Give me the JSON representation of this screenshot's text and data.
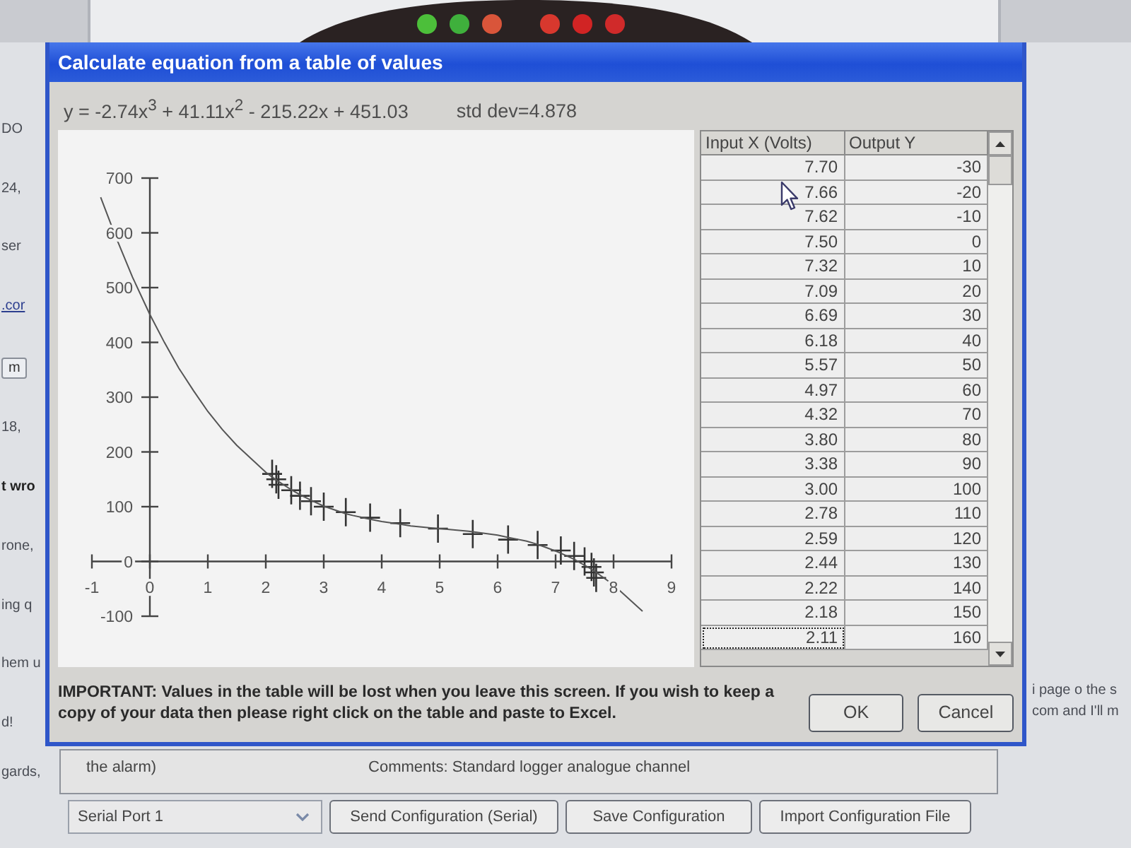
{
  "top_panel": {
    "indicators": [
      {
        "color": "#4cbf3a"
      },
      {
        "color": "#3fb03c"
      },
      {
        "color": "#d9553a"
      },
      {
        "color": "#d8382e"
      },
      {
        "color": "#d12424"
      },
      {
        "color": "#d02a2a"
      }
    ]
  },
  "page_behind": {
    "left_fragments": [
      {
        "kind": "text",
        "text": "DO"
      },
      {
        "kind": "text",
        "text": "24,"
      },
      {
        "kind": "text",
        "text": "ser"
      },
      {
        "kind": "link",
        "text": ".cor"
      },
      {
        "kind": "button",
        "text": "m"
      },
      {
        "kind": "text",
        "text": "18,"
      },
      {
        "kind": "bold",
        "text": "t wro"
      },
      {
        "kind": "text",
        "text": "rone,"
      },
      {
        "kind": "text",
        "text": "ing q"
      },
      {
        "kind": "text",
        "text": "hem u"
      },
      {
        "kind": "text",
        "text": "d!"
      }
    ],
    "right_fragments": [
      "i page o the s",
      "com and I'll m"
    ],
    "closing_fragment": "gards,",
    "comments_box": {
      "text": "the alarm)",
      "comments": "Comments:  Standard logger analogue channel"
    },
    "port_select": {
      "value": "Serial Port 1"
    },
    "buttons": [
      "Send Configuration (Serial)",
      "Save Configuration",
      "Import Configuration File"
    ]
  },
  "dialog": {
    "title": "Calculate equation from a table of values",
    "equation": "y = -2.74x$^{3}$ + 41.11x$^{2}$ - 215.22x + 451.03",
    "std_dev": "std dev=4.878",
    "chart_data": {
      "type": "scatter",
      "x": [
        -0.85,
        -0.6,
        -0.3,
        0,
        0.25,
        0.5,
        0.75,
        1,
        1.25,
        1.5,
        2,
        2.11,
        2.18,
        2.22,
        2.44,
        2.5,
        2.59,
        2.78,
        3,
        3.38,
        3.5,
        3.8,
        4,
        4.32,
        4.5,
        4.97,
        5,
        5.5,
        5.57,
        6,
        6.18,
        6.5,
        6.69,
        7,
        7.09,
        7.32,
        7.5,
        7.62,
        7.66,
        7.7,
        8,
        8.5
      ],
      "series": [
        {
          "type": "scatter",
          "values": [
            null,
            null,
            null,
            null,
            null,
            null,
            null,
            null,
            null,
            null,
            null,
            160,
            150,
            140,
            130,
            null,
            120,
            110,
            100,
            90,
            null,
            80,
            null,
            70,
            null,
            60,
            null,
            null,
            50,
            null,
            40,
            null,
            30,
            null,
            20,
            10,
            0,
            -10,
            -20,
            -30,
            null,
            null
          ]
        },
        {
          "type": "line",
          "values": [
            665,
            596,
            519,
            451,
            400,
            353,
            312,
            274,
            241,
            212,
            163,
            154,
            149,
            146,
            131,
            127,
            122,
            112,
            101,
            87,
            84,
            77,
            73,
            68,
            65,
            60,
            60,
            55,
            54,
            48,
            44,
            37,
            31,
            19,
            15,
            4,
            -7,
            -14,
            -17,
            -20,
            -43,
            -91
          ]
        }
      ],
      "xlim": [
        -1,
        9
      ],
      "ylim": [
        -100,
        700
      ],
      "xticks": [
        -1,
        0,
        1,
        2,
        3,
        4,
        5,
        6,
        7,
        8,
        9
      ],
      "yticks": [
        -100,
        0,
        100,
        200,
        300,
        400,
        500,
        600,
        700
      ]
    },
    "table": {
      "columns": [
        "Input X (Volts)",
        "Output Y"
      ],
      "rows": [
        {
          "cells": [
            "7.70",
            "-30"
          ],
          "focused": false
        },
        {
          "cells": [
            "7.66",
            "-20"
          ],
          "focused": false
        },
        {
          "cells": [
            "7.62",
            "-10"
          ],
          "focused": false
        },
        {
          "cells": [
            "7.50",
            "0"
          ],
          "focused": false
        },
        {
          "cells": [
            "7.32",
            "10"
          ],
          "focused": false
        },
        {
          "cells": [
            "7.09",
            "20"
          ],
          "focused": false
        },
        {
          "cells": [
            "6.69",
            "30"
          ],
          "focused": false
        },
        {
          "cells": [
            "6.18",
            "40"
          ],
          "focused": false
        },
        {
          "cells": [
            "5.57",
            "50"
          ],
          "focused": false
        },
        {
          "cells": [
            "4.97",
            "60"
          ],
          "focused": false
        },
        {
          "cells": [
            "4.32",
            "70"
          ],
          "focused": false
        },
        {
          "cells": [
            "3.80",
            "80"
          ],
          "focused": false
        },
        {
          "cells": [
            "3.38",
            "90"
          ],
          "focused": false
        },
        {
          "cells": [
            "3.00",
            "100"
          ],
          "focused": false
        },
        {
          "cells": [
            "2.78",
            "110"
          ],
          "focused": false
        },
        {
          "cells": [
            "2.59",
            "120"
          ],
          "focused": false
        },
        {
          "cells": [
            "2.44",
            "130"
          ],
          "focused": false
        },
        {
          "cells": [
            "2.22",
            "140"
          ],
          "focused": false
        },
        {
          "cells": [
            "2.18",
            "150"
          ],
          "focused": false
        },
        {
          "cells": [
            "2.11",
            "160"
          ],
          "focused": true
        }
      ]
    },
    "notice": "IMPORTANT: Values in the table will be lost when you leave this screen. If you wish to keep a copy of your data then please right click on the table and paste to Excel.",
    "buttons": [
      "OK",
      "Cancel"
    ]
  }
}
